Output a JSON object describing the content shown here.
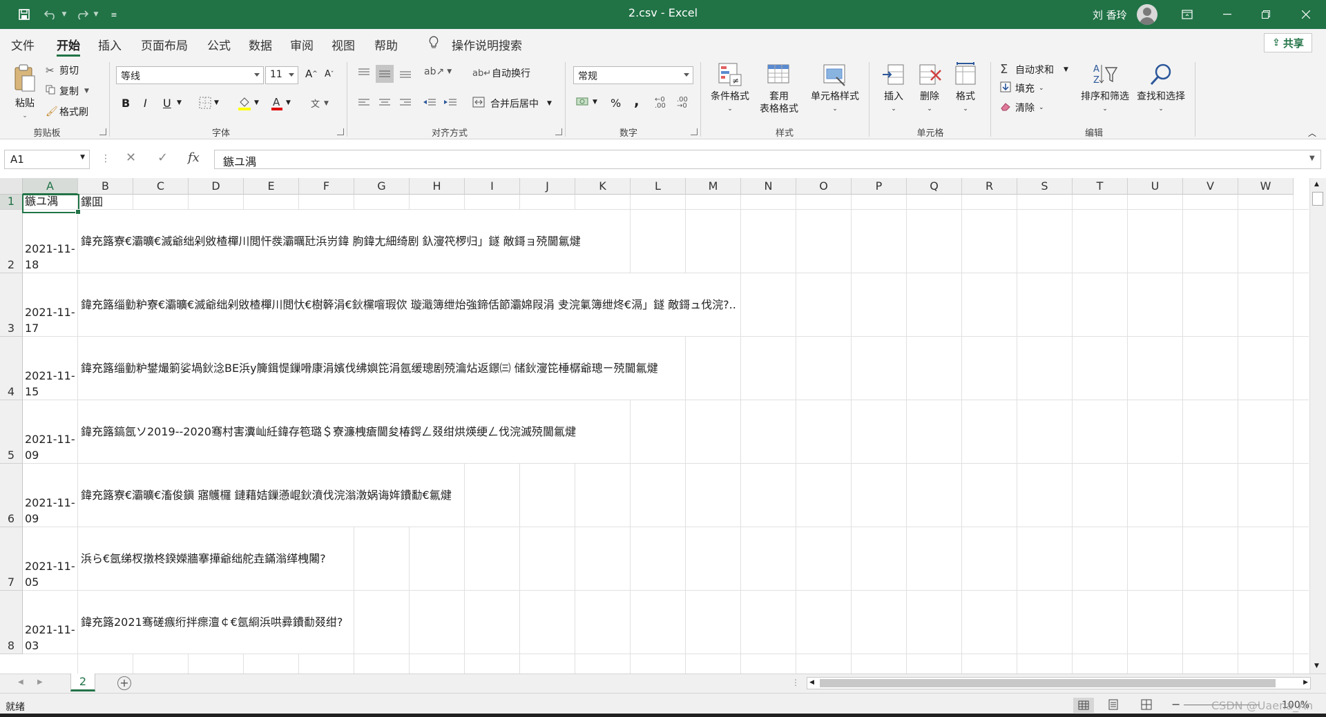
{
  "window": {
    "title": "2.csv  -  Excel",
    "user_name": "刘 香玲",
    "accent_color": "#217346"
  },
  "quick_access": {
    "icons": [
      "save-icon",
      "undo-icon",
      "redo-icon",
      "customize-icon"
    ]
  },
  "menu_tabs": [
    {
      "label": "文件"
    },
    {
      "label": "开始"
    },
    {
      "label": "插入"
    },
    {
      "label": "页面布局"
    },
    {
      "label": "公式"
    },
    {
      "label": "数据"
    },
    {
      "label": "审阅"
    },
    {
      "label": "视图"
    },
    {
      "label": "帮助"
    }
  ],
  "tell_me": "操作说明搜索",
  "share_label": "共享",
  "ribbon": {
    "clipboard": {
      "group": "剪贴板",
      "paste": "粘贴",
      "cut": "剪切",
      "copy": "复制",
      "format_painter": "格式刷"
    },
    "font": {
      "group": "字体",
      "name": "等线",
      "size": "11",
      "bold": "B",
      "italic": "I",
      "underline": "U"
    },
    "alignment": {
      "group": "对齐方式",
      "wrap": "自动换行",
      "merge": "合并后居中"
    },
    "number": {
      "group": "数字",
      "format": "常规",
      "percent": "%",
      "comma": ","
    },
    "styles": {
      "group": "样式",
      "conditional": "条件格式",
      "table_1": "套用",
      "table_2": "表格格式",
      "cell_styles": "单元格样式"
    },
    "cells": {
      "group": "单元格",
      "insert": "插入",
      "delete": "删除",
      "format": "格式"
    },
    "editing": {
      "group": "编辑",
      "autosum": "自动求和",
      "fill": "填充",
      "clear": "清除",
      "sort": "排序和筛选",
      "find": "查找和选择"
    }
  },
  "formula_bar": {
    "name_box": "A1",
    "fx": "fx",
    "content": "鏃ユ湡"
  },
  "columns": [
    "A",
    "B",
    "C",
    "D",
    "E",
    "F",
    "G",
    "H",
    "I",
    "J",
    "K",
    "L",
    "M",
    "N",
    "O",
    "P",
    "Q",
    "R",
    "S",
    "T",
    "U",
    "V",
    "W"
  ],
  "rows": [
    {
      "num": "1",
      "a": "鏃ユ湡",
      "b": "鏍囬"
    },
    {
      "num": "2",
      "a": "2021-11-\n18",
      "b": "鍏充簬寮€灞曠€滅爺绌剁敓楂樿川閲忓彂灞曞瓧浜岃鍏   朐鍏尢細绮剧   釞濅笩椤归」鐩   敵鎶ョ殑閫氱煡"
    },
    {
      "num": "3",
      "a": "2021-11-\n17",
      "b": "鍏充簬缁勭粐寮€灞曠€滅爺绌剁敓楂樿川閲忕€樹簳涓€鈥欓噾瑕佽   璇濈簿绁炲強鍗佸節灞婂叚涓   叏浣氭簿绁炵€滆」鐩   敵鎶ュ伐浣?.."
    },
    {
      "num": "4",
      "a": "2021-11-\n15",
      "b": "鍏充簬缁勭粐鐢熶箣娑堝鈥淰BE浜у簲鍓惿鏁嗗康涓嬪伐绋嬩笓涓氬缓璁剧殑瀹炶返鐛㈢ 储鈥濅笓棰樼爺璁ㄧ殑閫氱煡"
    },
    {
      "num": "5",
      "a": "2021-11-\n09",
      "b": "鍏充簬鎬氬ソ2019--2020骞村害瀵屾紝鍏存笣璐＄寮濂栧瘡閫夋椿鍔ㄥ叕绀烘煐绠ㄥ伐浣滅殑閫氱煡"
    },
    {
      "num": "6",
      "a": "2021-11-\n09",
      "b": "鍏充簬寮€灞曠€滀俊鎭    寤鸌欏    鏈藉姞鏁懣崐鈥濆伐浣滃潡娲诲姩鐨勫€氱煡"
    },
    {
      "num": "7",
      "a": "2021-11-\n05",
      "b": "浜ら€氬绨杈撴柊鍨嬫牆搴撶爺绌舵垚鏋滃缂栧闂?"
    },
    {
      "num": "8",
      "a": "2021-11-\n03",
      "b": "鍏充簬2021骞磋瘯绗拌瘝澶￠€氬綗浜哄彛鐨勫叕绀?"
    }
  ],
  "sheet_tab": "2",
  "status": {
    "ready": "就绪",
    "zoom": "100%",
    "watermark": "CSDN @Uaena_An"
  }
}
